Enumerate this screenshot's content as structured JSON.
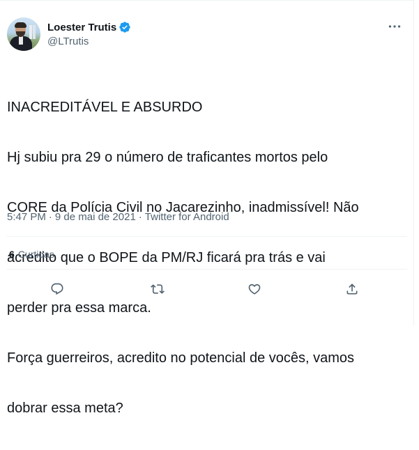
{
  "author": {
    "display_name": "Loester Trutis",
    "handle": "@LTrutis",
    "verified": true,
    "avatar_icon": "profile-photo"
  },
  "tweet": {
    "lines": [
      "INACREDITÁVEL E ABSURDO",
      "Hj subiu pra 29 o número de traficantes mortos pelo",
      "CORE da Polícia Civil no Jacarezinho, inadmissível! Não",
      "acredito que o BOPE da PM/RJ ficará pra trás e vai",
      "perder pra essa marca.",
      "Força guerreiros, acredito no potencial de vocês, vamos",
      "dobrar essa meta?"
    ]
  },
  "meta": {
    "time": "5:47 PM",
    "separator": "·",
    "date": "9 de mai de 2021",
    "source": "Twitter for Android"
  },
  "stats": {
    "likes_count": "6",
    "likes_label": "Curtidas"
  },
  "actions": {
    "icons": [
      "reply-icon",
      "retweet-icon",
      "like-icon",
      "share-icon"
    ]
  },
  "colors": {
    "accent": "#1d9bf0",
    "text_primary": "#0f1419",
    "text_secondary": "#536471",
    "divider": "#eff3f4"
  }
}
